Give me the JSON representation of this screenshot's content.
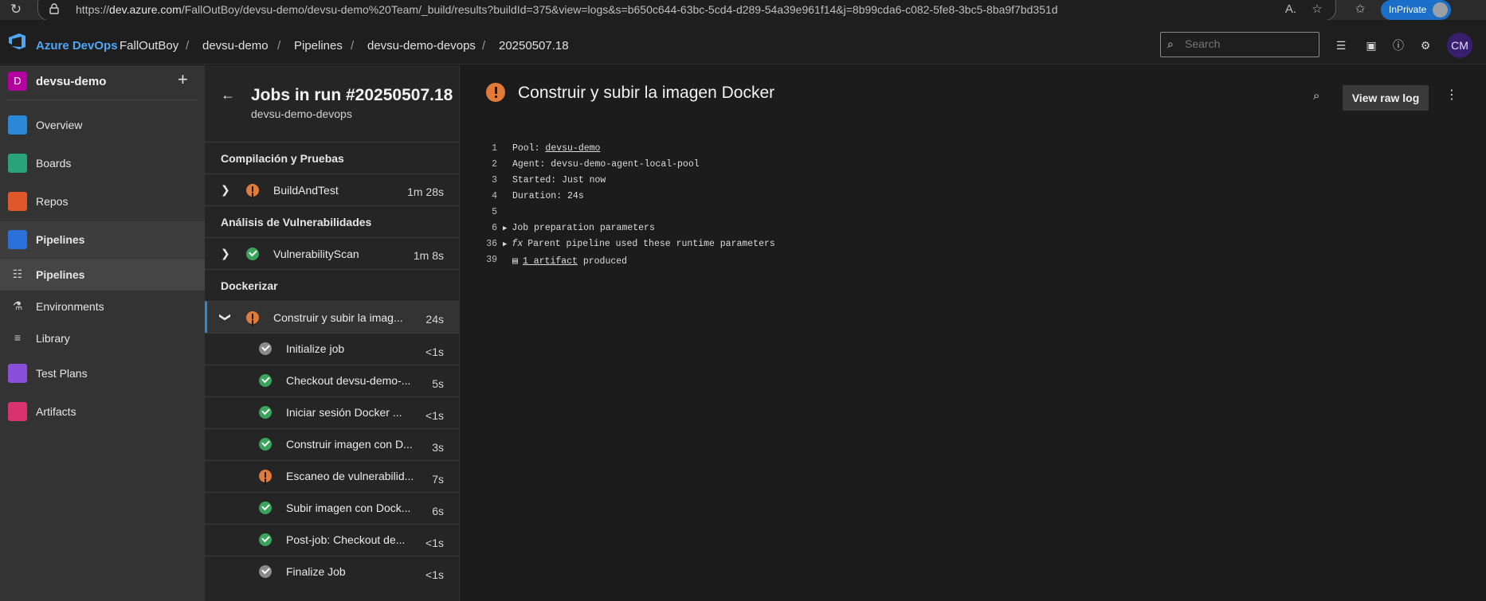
{
  "browser": {
    "url_prefix": "https://",
    "url_host": "dev.azure.com",
    "url_path": "/FallOutBoy/devsu-demo/devsu-demo%20Team/_build/results?buildId=375&view=logs&s=b650c644-63bc-5cd4-d289-54a39e961f14&j=8b99cda6-c082-5fe8-3bc5-8ba9f7bd351d",
    "inprivate_label": "InPrivate"
  },
  "header": {
    "brand": "Azure DevOps",
    "breadcrumbs": [
      "FallOutBoy",
      "devsu-demo",
      "Pipelines",
      "devsu-demo-devops",
      "20250507.18"
    ],
    "search_placeholder": "Search",
    "user_initials": "CM"
  },
  "sidebar": {
    "project_initial": "D",
    "project_name": "devsu-demo",
    "items": [
      {
        "label": "Overview",
        "icon": "overview-icon",
        "color": "#2b88d8"
      },
      {
        "label": "Boards",
        "icon": "boards-icon",
        "color": "#2aa37b"
      },
      {
        "label": "Repos",
        "icon": "repos-icon",
        "color": "#e0582a"
      },
      {
        "label": "Pipelines",
        "icon": "pipelines-icon",
        "color": "#2b6fd8"
      },
      {
        "label": "Test Plans",
        "icon": "test-plans-icon",
        "color": "#8a4fd8"
      },
      {
        "label": "Artifacts",
        "icon": "artifacts-icon",
        "color": "#d8336e"
      }
    ],
    "sub_items": [
      {
        "label": "Pipelines",
        "icon": "pipelines-sub-icon"
      },
      {
        "label": "Environments",
        "icon": "environments-icon"
      },
      {
        "label": "Library",
        "icon": "library-icon"
      }
    ]
  },
  "jobs": {
    "title": "Jobs in run #20250507.18",
    "subtitle": "devsu-demo-devops",
    "stages": [
      {
        "name": "Compilación y Pruebas",
        "job": {
          "name": "BuildAndTest",
          "duration": "1m 28s",
          "status": "warning"
        }
      },
      {
        "name": "Análisis de Vulnerabilidades",
        "job": {
          "name": "VulnerabilityScan",
          "duration": "1m 8s",
          "status": "succeeded"
        }
      },
      {
        "name": "Dockerizar",
        "job": {
          "name": "Construir y subir la imag...",
          "duration": "24s",
          "status": "warning"
        }
      }
    ],
    "steps": [
      {
        "name": "Initialize job",
        "duration": "<1s",
        "status": "skipped"
      },
      {
        "name": "Checkout devsu-demo-...",
        "duration": "5s",
        "status": "succeeded"
      },
      {
        "name": "Iniciar sesión Docker ...",
        "duration": "<1s",
        "status": "succeeded"
      },
      {
        "name": "Construir imagen con D...",
        "duration": "3s",
        "status": "succeeded"
      },
      {
        "name": "Escaneo de vulnerabilid...",
        "duration": "7s",
        "status": "warning"
      },
      {
        "name": "Subir imagen con Dock...",
        "duration": "6s",
        "status": "succeeded"
      },
      {
        "name": "Post-job: Checkout de...",
        "duration": "<1s",
        "status": "succeeded"
      },
      {
        "name": "Finalize Job",
        "duration": "<1s",
        "status": "skipped"
      }
    ]
  },
  "log": {
    "title": "Construir y subir la imagen Docker",
    "raw_button": "View raw log",
    "lines": [
      {
        "n": "1",
        "prefix": "Pool: ",
        "link": "devsu-demo",
        "suffix": ""
      },
      {
        "n": "2",
        "prefix": "Agent: devsu-demo-agent-local-pool",
        "link": "",
        "suffix": ""
      },
      {
        "n": "3",
        "prefix": "Started: Just now",
        "link": "",
        "suffix": ""
      },
      {
        "n": "4",
        "prefix": "Duration: 24s",
        "link": "",
        "suffix": ""
      },
      {
        "n": "5",
        "prefix": "",
        "link": "",
        "suffix": ""
      },
      {
        "n": "6",
        "prefix": "Job preparation parameters",
        "link": "",
        "suffix": ""
      },
      {
        "n": "36",
        "prefix": "Parent pipeline used these runtime parameters",
        "link": "",
        "suffix": ""
      },
      {
        "n": "39",
        "prefix": "",
        "link": "1 artifact",
        "suffix": " produced"
      }
    ]
  }
}
